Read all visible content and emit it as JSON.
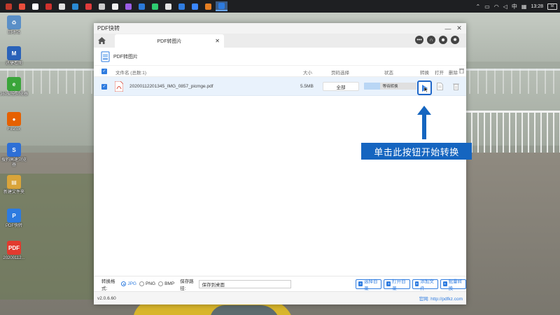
{
  "desktop_icons": [
    {
      "label": "回收站",
      "color": "#5a8fc7",
      "glyph": "♻"
    },
    {
      "label": "迅捷看图",
      "color": "#2a62b9",
      "glyph": "M"
    },
    {
      "label": "360安全浏览器",
      "color": "#3aa53a",
      "glyph": "e"
    },
    {
      "label": "Firefox",
      "color": "#e66000",
      "glyph": "●"
    },
    {
      "label": "搜狗高速浏览器",
      "color": "#2e6fd6",
      "glyph": "S"
    },
    {
      "label": "新建文件夹",
      "color": "#d9a43a",
      "glyph": "▤"
    },
    {
      "label": "PDF快转",
      "color": "#2d7be0",
      "glyph": "P"
    },
    {
      "label": "20200112...",
      "color": "#e23a2e",
      "glyph": "PDF"
    }
  ],
  "taskbar": {
    "apps": [
      "#c0392b",
      "#e94e3c",
      "#ffffff",
      "#d0312d",
      "#e0e0e0",
      "#2a8ad4",
      "#e03b3b",
      "#cccccc",
      "#f0f0f0",
      "#9b5de5",
      "#2b79d9",
      "#2ecc71",
      "#e5e5e5",
      "#2f7ce0",
      "#3a86ff",
      "#e67e22",
      "#2d7be0"
    ],
    "ime": "中",
    "time": "13:28",
    "notify": "lxl"
  },
  "window": {
    "title": "PDF快转",
    "tab_label": "PDF转图片",
    "section_title": "PDF转图片",
    "columns": {
      "name": "文件名 (总数:1)",
      "size": "大小",
      "range": "页码选择",
      "status": "状态",
      "convert": "转换",
      "open": "打开",
      "delete": "删除"
    },
    "file": {
      "name": "20200112201345_IMG_0857_picmge.pdf",
      "size": "5.5MB",
      "range": "全部",
      "status": "等待转换",
      "progress": 0.3
    },
    "footer": {
      "format_label": "转换格式:",
      "formats": [
        "JPG",
        "PNG",
        "BMP"
      ],
      "selected_format": "JPG",
      "save_label": "保存路径:",
      "save_path": "保存到桌面",
      "buttons": [
        "选择目录",
        "打开目录",
        "添加文件",
        "批量转换"
      ]
    },
    "version": "v2.0.6.60",
    "website": "官网: http://pdfkz.com"
  },
  "callout": {
    "text": "单击此按钮开始转换",
    "color": "#1565c0"
  }
}
